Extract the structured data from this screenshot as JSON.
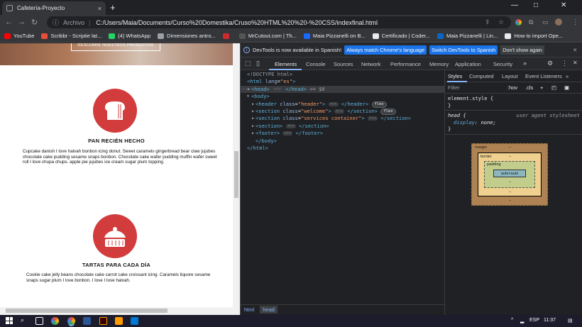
{
  "browser": {
    "tab_title": "Cafetería-Proyecto",
    "tab_close": "×",
    "new_tab": "+",
    "window_controls": {
      "minimize": "—",
      "maximize": "□",
      "close": "✕"
    },
    "omnibox": {
      "scheme_label": "Archivo",
      "separator": "|",
      "url": "C:/Users/Maia/Documents/Curso%20Domestika/Cruso%20HTML%20%20-%20CSS/indexfinal.html"
    }
  },
  "bookmarks": [
    {
      "label": "YouTube",
      "icon": "youtube-icon",
      "color": "#ff0000"
    },
    {
      "label": "Scribbr - Scriptie lat...",
      "icon": "scribbr-icon",
      "color": "#e94e3c"
    },
    {
      "label": "(4) WhatsApp",
      "icon": "whatsapp-icon",
      "color": "#25d366"
    },
    {
      "label": "Dimensiones antro...",
      "icon": "globe-icon",
      "color": "#9aa0a6"
    },
    {
      "label": "",
      "icon": "red-icon",
      "color": "#cc2b2b"
    },
    {
      "label": "MrCutout.com | Th...",
      "icon": "mrcutout-icon",
      "color": "#555555"
    },
    {
      "label": "Maia Pizzanelli on B...",
      "icon": "behance-icon",
      "color": "#1769ff"
    },
    {
      "label": "Certificado | Coder...",
      "icon": "coder-icon",
      "color": "#e8eaed"
    },
    {
      "label": "Maia Pizzanelli | Lin...",
      "icon": "linkedin-icon",
      "color": "#0a66c2"
    },
    {
      "label": "How to import Ope...",
      "icon": "import-icon",
      "color": "#e8eaed"
    }
  ],
  "page": {
    "hero_button": "DESCUBRE NUESTROS PRODUCTOS",
    "services": [
      {
        "icon": "bread-icon",
        "title": "PAN RECIÉN HECHO",
        "text": "Cupcake danish I love halvah bonbon icing donut. Sweet caramels gingerbread bear claw jujubes chocolate cake pudding sesame snaps bonbon. Chocolate cake wafer pudding muffin wafer sweet roll I love chupa chups. apple pie jujubes ice cream sugar plum topping."
      },
      {
        "icon": "cake-icon",
        "title": "TARTAS PARA CADA DÍA",
        "text": "Cookie cake jelly beans chocolate cake carrot cake croissant icing. Caramels liquore sesame snaps sugar plum I love bonbon. I love I love halvah."
      }
    ]
  },
  "devtools": {
    "banner": {
      "text": "DevTools is now available in Spanish!",
      "btn_match": "Always match Chrome's language",
      "btn_switch": "Switch DevTools to Spanish",
      "btn_dismiss": "Don't show again",
      "close": "✕"
    },
    "tabs": [
      "Elements",
      "Console",
      "Sources",
      "Network",
      "Performance",
      "Memory",
      "Application",
      "Security"
    ],
    "more": "»",
    "elements": [
      {
        "indent": 0,
        "html": "<span class='cm'>&lt;!DOCTYPE html&gt;</span>"
      },
      {
        "indent": 0,
        "html": "<span class='tg'>&lt;html</span> <span class='at'>lang</span>=<span class='av'>\"es\"</span><span class='tg'>&gt;</span>"
      },
      {
        "indent": 1,
        "selected": true,
        "html": "<span class='tg'>&lt;head&gt;</span> <span class='ell'>···</span> <span class='tg'>&lt;/head&gt;</span> <span class='cm'>== $0</span>"
      },
      {
        "indent": 1,
        "open": true,
        "html": "<span class='tg'>&lt;body&gt;</span>"
      },
      {
        "indent": 2,
        "html": "<span class='tg'>&lt;header</span> <span class='at'>class</span>=<span class='av'>\"header\"</span><span class='tg'>&gt;</span> <span class='ell'>···</span> <span class='tg'>&lt;/header&gt;</span> <span class='pill'>flex</span>"
      },
      {
        "indent": 2,
        "html": "<span class='tg'>&lt;section</span> <span class='at'>class</span>=<span class='av'>\"welcome\"</span><span class='tg'>&gt;</span> <span class='ell'>···</span> <span class='tg'>&lt;/section&gt;</span> <span class='pill'>flex</span>"
      },
      {
        "indent": 2,
        "html": "<span class='tg'>&lt;section</span> <span class='at'>class</span>=<span class='av'>\"services container\"</span><span class='tg'>&gt;</span> <span class='ell'>···</span> <span class='tg'>&lt;/section&gt;</span>"
      },
      {
        "indent": 2,
        "html": "<span class='tg'>&lt;section&gt;</span> <span class='ell'>···</span> <span class='tg'>&lt;/section&gt;</span>"
      },
      {
        "indent": 2,
        "html": "<span class='tg'>&lt;footer&gt;</span> <span class='ell'>···</span> <span class='tg'>&lt;/footer&gt;</span>"
      },
      {
        "indent": 2,
        "html": "<span class='tg'>&lt;/body&gt;</span>"
      },
      {
        "indent": 0,
        "html": "<span class='tg'>&lt;/html&gt;</span>"
      }
    ],
    "breadcrumbs": [
      "html",
      "head"
    ],
    "styles": {
      "tabs": [
        "Styles",
        "Computed",
        "Layout",
        "Event Listeners"
      ],
      "filter_placeholder": "Filter",
      "hov": ":hov",
      "cls": ".cls",
      "rule1_selector": "element.style {",
      "rule1_close": "}",
      "rule2_selector": "head {",
      "rule2_source": "user agent stylesheet",
      "rule2_prop": "display",
      "rule2_value": "none;",
      "rule2_close": "}",
      "box_model": {
        "margin": "margin",
        "border": "border",
        "padding": "padding",
        "content": "auto×auto",
        "dash": "–"
      }
    }
  },
  "taskbar": {
    "lang": "ESP",
    "time": "11:37"
  }
}
